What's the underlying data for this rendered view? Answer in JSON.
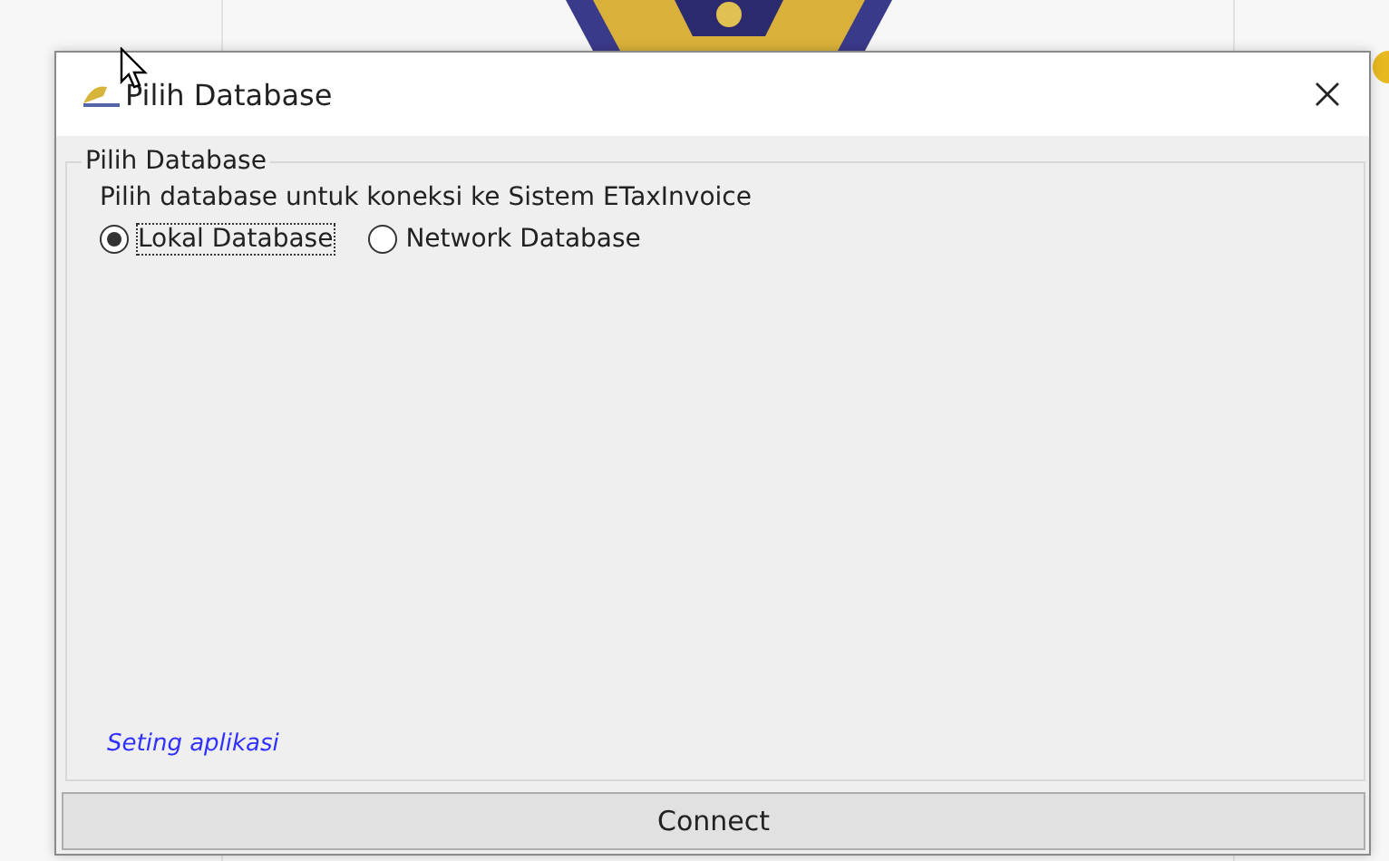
{
  "window": {
    "title": "Pilih Database"
  },
  "group": {
    "title": "Pilih Database",
    "description": "Pilih database untuk koneksi ke Sistem ETaxInvoice",
    "options": [
      {
        "label": "Lokal Database",
        "selected": true,
        "focused": true
      },
      {
        "label": "Network Database",
        "selected": false,
        "focused": false
      }
    ],
    "link": "Seting aplikasi"
  },
  "buttons": [
    {
      "label": "Connect"
    }
  ]
}
